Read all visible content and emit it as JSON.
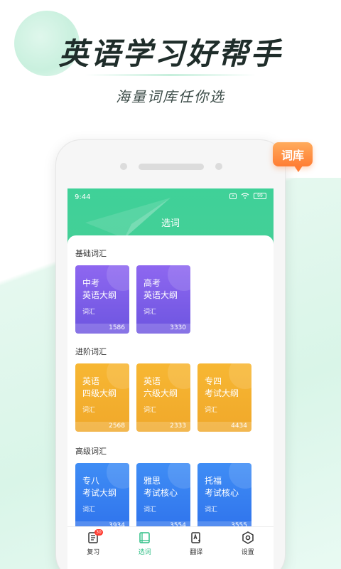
{
  "promo": {
    "headline": "英语学习好帮手",
    "subline": "海量词库任你选",
    "tag": "词库"
  },
  "status": {
    "time": "9:44",
    "battery": "99"
  },
  "header": {
    "title": "选词"
  },
  "sections": [
    {
      "title": "基础词汇",
      "cards": [
        {
          "line1": "中考",
          "line2": "英语大纲",
          "sub": "词汇",
          "count": "1586"
        },
        {
          "line1": "高考",
          "line2": "英语大纲",
          "sub": "词汇",
          "count": "3330"
        }
      ]
    },
    {
      "title": "进阶词汇",
      "cards": [
        {
          "line1": "英语",
          "line2": "四级大纲",
          "sub": "词汇",
          "count": "2568"
        },
        {
          "line1": "英语",
          "line2": "六级大纲",
          "sub": "词汇",
          "count": "2333"
        },
        {
          "line1": "专四",
          "line2": "考试大纲",
          "sub": "词汇",
          "count": "4434"
        }
      ]
    },
    {
      "title": "高级词汇",
      "cards": [
        {
          "line1": "专八",
          "line2": "考试大纲",
          "sub": "词汇",
          "count": "3934"
        },
        {
          "line1": "雅思",
          "line2": "考试核心",
          "sub": "词汇",
          "count": "3554"
        },
        {
          "line1": "托福",
          "line2": "考试核心",
          "sub": "词汇",
          "count": "3555"
        }
      ]
    }
  ],
  "nav": [
    {
      "label": "复习",
      "icon": "review-book-icon",
      "badge": "30"
    },
    {
      "label": "选词",
      "icon": "wordbook-icon"
    },
    {
      "label": "翻译",
      "icon": "translate-icon"
    },
    {
      "label": "设置",
      "icon": "settings-icon"
    }
  ],
  "colors": {
    "brand_green": "#44cf97",
    "purple": "#7b5ce8",
    "orange": "#f4ae2e",
    "blue": "#3580f0",
    "tag_orange": "#ff8c3a",
    "badge_red": "#ff3b30"
  }
}
